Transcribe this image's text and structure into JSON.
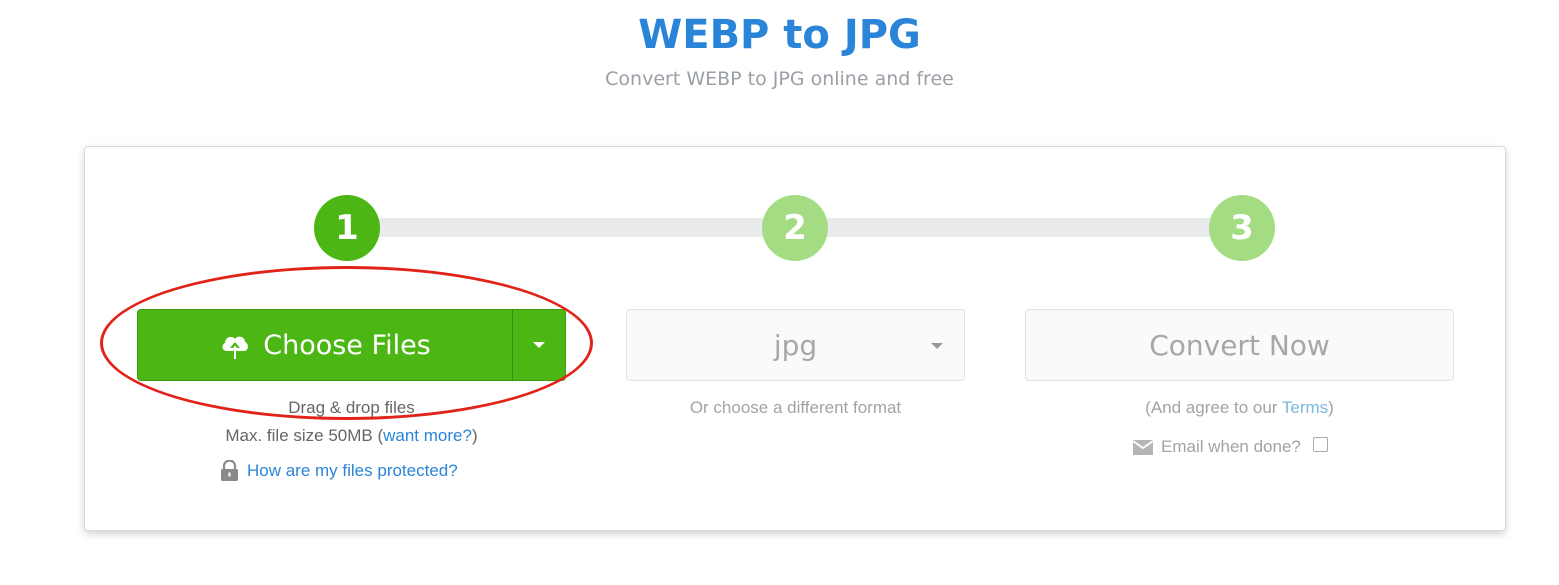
{
  "page": {
    "title": "WEBP to JPG",
    "subtitle": "Convert WEBP to JPG online and free"
  },
  "steps": [
    "1",
    "2",
    "3"
  ],
  "upload": {
    "button_label": "Choose Files",
    "drag_text": "Drag & drop files",
    "max_prefix": "Max. file size 50MB (",
    "want_more": "want more?",
    "max_suffix": ")",
    "protect_link": "How are my files protected?"
  },
  "format": {
    "selected": "jpg",
    "hint": "Or choose a different format"
  },
  "convert": {
    "button_label": "Convert Now",
    "terms_prefix": "(And agree to our ",
    "terms_link": "Terms",
    "terms_suffix": ")",
    "email_label": "Email when done?",
    "email_checked": false
  },
  "icons": {
    "upload": "cloud-upload-icon",
    "dropdown": "caret-down-icon",
    "lock": "lock-icon",
    "email": "envelope-icon"
  },
  "colors": {
    "title": "#2a84d8",
    "primary_green": "#4cb714",
    "inactive_step": "#a4dc84",
    "link": "#2a84d8",
    "annotation": "#e2231a"
  }
}
